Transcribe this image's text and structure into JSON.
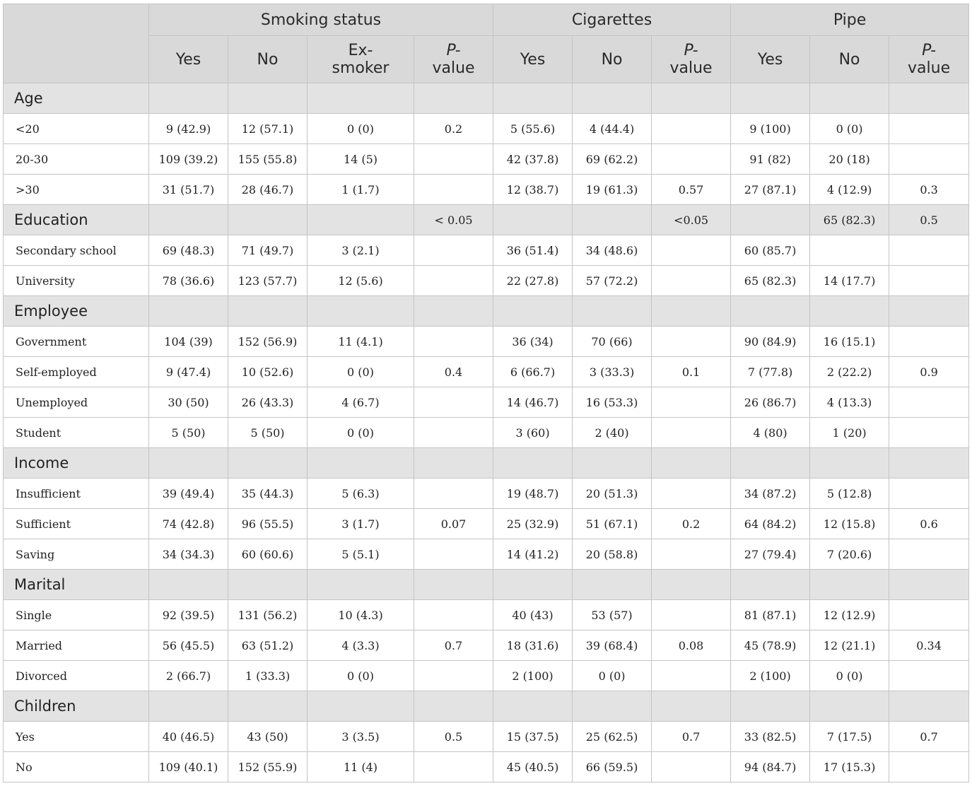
{
  "header": {
    "groups": [
      "Smoking status",
      "Cigarettes",
      "Pipe"
    ],
    "smoking_status": {
      "yes": "Yes",
      "no": "No",
      "ex_line1": "Ex-",
      "ex_line2": "smoker",
      "p_line1": "P-",
      "p_line2": "value"
    },
    "cigarettes": {
      "yes": "Yes",
      "no": "No",
      "p_line1": "P-",
      "p_line2": "value"
    },
    "pipe": {
      "yes": "Yes",
      "no": "No",
      "p_line1": "P-",
      "p_line2": "value"
    }
  },
  "sections": [
    {
      "label": "Age",
      "values": [
        "",
        "",
        "",
        "",
        "",
        "",
        "",
        "",
        "",
        ""
      ],
      "rows": [
        {
          "label": "<20",
          "cells": [
            "9 (42.9)",
            "12 (57.1)",
            "0 (0)",
            "0.2",
            "5 (55.6)",
            "4 (44.4)",
            "",
            "9 (100)",
            "0 (0)",
            ""
          ]
        },
        {
          "label": "20-30",
          "cells": [
            "109 (39.2)",
            "155 (55.8)",
            "14 (5)",
            "",
            "42 (37.8)",
            "69 (62.2)",
            "",
            "91 (82)",
            "20 (18)",
            ""
          ]
        },
        {
          "label": ">30",
          "cells": [
            "31 (51.7)",
            "28 (46.7)",
            "1 (1.7)",
            "",
            "12 (38.7)",
            "19 (61.3)",
            "0.57",
            "27 (87.1)",
            "4 (12.9)",
            "0.3"
          ]
        }
      ]
    },
    {
      "label": "Education",
      "values": [
        "",
        "",
        "",
        "< 0.05",
        "",
        "",
        "<0.05",
        "",
        "65 (82.3)",
        "0.5"
      ],
      "rows": [
        {
          "label": "Secondary school",
          "cells": [
            "69 (48.3)",
            "71 (49.7)",
            "3 (2.1)",
            "",
            "36 (51.4)",
            "34 (48.6)",
            "",
            "60 (85.7)",
            "",
            ""
          ]
        },
        {
          "label": "University",
          "cells": [
            "78 (36.6)",
            "123 (57.7)",
            "12 (5.6)",
            "",
            "22 (27.8)",
            "57 (72.2)",
            "",
            "65 (82.3)",
            "14 (17.7)",
            ""
          ]
        }
      ]
    },
    {
      "label": "Employee",
      "values": [
        "",
        "",
        "",
        "",
        "",
        "",
        "",
        "",
        "",
        ""
      ],
      "rows": [
        {
          "label": "Government",
          "cells": [
            "104 (39)",
            "152 (56.9)",
            "11 (4.1)",
            "",
            "36 (34)",
            "70 (66)",
            "",
            "90 (84.9)",
            "16 (15.1)",
            ""
          ]
        },
        {
          "label": "Self-employed",
          "cells": [
            "9 (47.4)",
            "10 (52.6)",
            "0 (0)",
            "0.4",
            "6 (66.7)",
            "3 (33.3)",
            "0.1",
            "7 (77.8)",
            "2 (22.2)",
            "0.9"
          ]
        },
        {
          "label": "Unemployed",
          "cells": [
            "30 (50)",
            "26 (43.3)",
            "4 (6.7)",
            "",
            "14 (46.7)",
            "16 (53.3)",
            "",
            "26 (86.7)",
            "4 (13.3)",
            ""
          ]
        },
        {
          "label": "Student",
          "cells": [
            "5 (50)",
            "5 (50)",
            "0 (0)",
            "",
            "3 (60)",
            "2 (40)",
            "",
            "4 (80)",
            "1 (20)",
            ""
          ]
        }
      ]
    },
    {
      "label": "Income",
      "values": [
        "",
        "",
        "",
        "",
        "",
        "",
        "",
        "",
        "",
        ""
      ],
      "rows": [
        {
          "label": "Insufficient",
          "cells": [
            "39 (49.4)",
            "35 (44.3)",
            "5 (6.3)",
            "",
            "19 (48.7)",
            "20 (51.3)",
            "",
            "34 (87.2)",
            "5 (12.8)",
            ""
          ]
        },
        {
          "label": "Sufficient",
          "cells": [
            "74 (42.8)",
            "96 (55.5)",
            "3 (1.7)",
            "0.07",
            "25 (32.9)",
            "51 (67.1)",
            "0.2",
            "64 (84.2)",
            "12 (15.8)",
            "0.6"
          ]
        },
        {
          "label": "Saving",
          "cells": [
            "34 (34.3)",
            "60 (60.6)",
            "5 (5.1)",
            "",
            "14 (41.2)",
            "20 (58.8)",
            "",
            "27 (79.4)",
            "7 (20.6)",
            ""
          ]
        }
      ]
    },
    {
      "label": "Marital",
      "values": [
        "",
        "",
        "",
        "",
        "",
        "",
        "",
        "",
        "",
        ""
      ],
      "rows": [
        {
          "label": "Single",
          "cells": [
            "92 (39.5)",
            "131 (56.2)",
            "10 (4.3)",
            "",
            "40 (43)",
            "53 (57)",
            "",
            "81 (87.1)",
            "12 (12.9)",
            ""
          ]
        },
        {
          "label": "Married",
          "cells": [
            "56 (45.5)",
            "63 (51.2)",
            "4 (3.3)",
            "0.7",
            "18 (31.6)",
            "39 (68.4)",
            "0.08",
            "45 (78.9)",
            "12 (21.1)",
            "0.34"
          ]
        },
        {
          "label": "Divorced",
          "cells": [
            "2 (66.7)",
            "1 (33.3)",
            "0 (0)",
            "",
            "2 (100)",
            "0 (0)",
            "",
            "2 (100)",
            "0 (0)",
            ""
          ]
        }
      ]
    },
    {
      "label": "Children",
      "values": [
        "",
        "",
        "",
        "",
        "",
        "",
        "",
        "",
        "",
        ""
      ],
      "rows": [
        {
          "label": "Yes",
          "cells": [
            "40 (46.5)",
            "43 (50)",
            "3 (3.5)",
            "0.5",
            "15 (37.5)",
            "25 (62.5)",
            "0.7",
            "33 (82.5)",
            "7 (17.5)",
            "0.7"
          ]
        },
        {
          "label": "No",
          "cells": [
            "109 (40.1)",
            "152 (55.9)",
            "11 (4)",
            "",
            "45 (40.5)",
            "66 (59.5)",
            "",
            "94 (84.7)",
            "17 (15.3)",
            ""
          ]
        }
      ]
    }
  ]
}
